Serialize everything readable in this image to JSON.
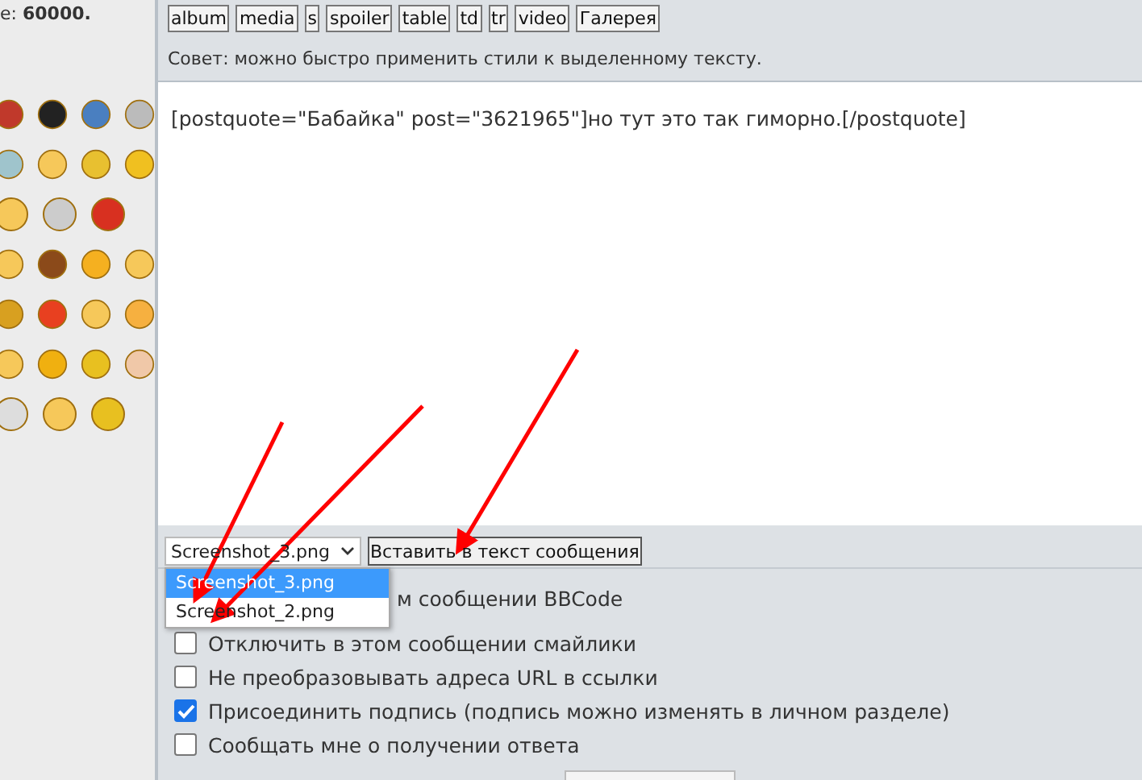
{
  "sidebar": {
    "limit_text": "e: **60000.**"
  },
  "tag_buttons": [
    "album",
    "media",
    "s",
    "spoiler",
    "table",
    "td",
    "tr",
    "video",
    "Галерея"
  ],
  "hint": "Совет: можно быстро применить стили к выделенному тексту.",
  "editor": {
    "value": "[postquote=\"Бабайка\" post=\"3621965\"]но тут это так гиморно.[/postquote]"
  },
  "attachment": {
    "select_value": "Screenshot_3.png",
    "insert_button": "Вставить в текст сообщения",
    "options": [
      {
        "label": "Screenshot_3.png",
        "selected": true
      },
      {
        "label": "Screenshot_2.png",
        "selected": false
      }
    ]
  },
  "options": [
    {
      "label": "м сообщении BBCode"
    },
    {
      "label": "Отключить в этом сообщении смайлики",
      "checked": false
    },
    {
      "label": "Не преобразовывать адреса URL в ссылки",
      "checked": false
    },
    {
      "label": "Присоединить подпись (подпись можно изменять в личном разделе)",
      "checked": true
    },
    {
      "label": "Сообщать мне о получении ответа",
      "checked": false
    }
  ]
}
